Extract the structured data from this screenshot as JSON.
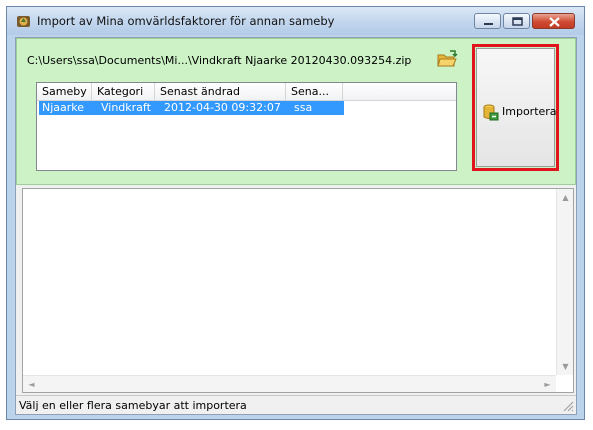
{
  "window": {
    "title": "Import av Mina omvärldsfaktorer för annan sameby",
    "icon": "app-icon",
    "controls": [
      "minimize-icon",
      "maximize-icon",
      "close-icon"
    ]
  },
  "file": {
    "path": "C:\\Users\\ssa\\Documents\\Mi...\\Vindkraft Njaarke 20120430.093254.zip",
    "browse_icon": "open-folder-icon"
  },
  "list": {
    "columns": [
      "Sameby",
      "Kategori",
      "Senast ändrad",
      "Sena..."
    ],
    "rows": [
      {
        "sameby": "Njaarke",
        "kategori": "Vindkraft",
        "senast_andrad": "2012-04-30 09:32:07",
        "sena": "ssa",
        "selected": true
      }
    ]
  },
  "import_button": {
    "label": "Importera",
    "icon": "database-import-icon"
  },
  "log": {
    "text": ""
  },
  "status": {
    "text": "Välj en eller flera samebyar att importera"
  },
  "colors": {
    "panel_green": "#ccf2c6",
    "selection_blue": "#3399ff",
    "highlight_red": "#e0141c",
    "title_bar": "#c3d7ee"
  }
}
